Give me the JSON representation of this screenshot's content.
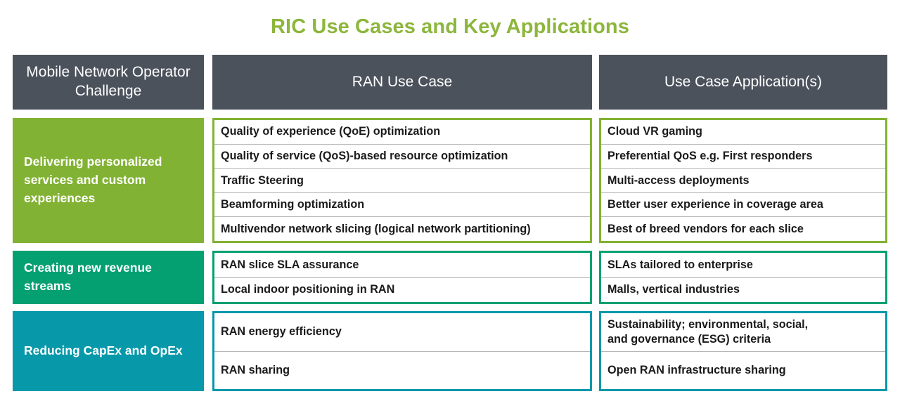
{
  "title": "RIC Use Cases and Key Applications",
  "colors": {
    "title_green": "#8CB63C",
    "header_gray": "#4C525C",
    "green": "#82B233",
    "teal": "#05A072",
    "cyan": "#0798A9",
    "row_divider": "#b7b7b7"
  },
  "headers": {
    "challenge": "Mobile Network\nOperator Challenge",
    "use_case": "RAN Use Case",
    "applications": "Use Case Application(s)"
  },
  "sections": [
    {
      "id": "personalized-services",
      "color": "#82B233",
      "challenge": "Delivering personalized services and custom experiences",
      "use_cases": [
        "Quality of experience (QoE) optimization",
        "Quality of service (QoS)-based resource optimization",
        "Traffic Steering",
        "Beamforming optimization",
        "Multivendor network slicing (logical network partitioning)"
      ],
      "applications": [
        "Cloud VR gaming",
        "Preferential QoS e.g. First responders",
        "Multi-access deployments",
        "Better user experience in coverage area",
        "Best of breed vendors for each slice"
      ]
    },
    {
      "id": "new-revenue-streams",
      "color": "#05A072",
      "challenge": "Creating new revenue streams",
      "use_cases": [
        "RAN slice SLA assurance",
        "Local indoor positioning in RAN"
      ],
      "applications": [
        "SLAs tailored to enterprise",
        "Malls, vertical industries"
      ]
    },
    {
      "id": "reducing-capex-opex",
      "color": "#0798A9",
      "challenge": "Reducing CapEx and OpEx",
      "use_cases": [
        "RAN energy efficiency",
        "RAN sharing"
      ],
      "applications": [
        "Sustainability; environmental, social,\nand governance (ESG) criteria",
        "Open RAN infrastructure sharing"
      ]
    }
  ]
}
